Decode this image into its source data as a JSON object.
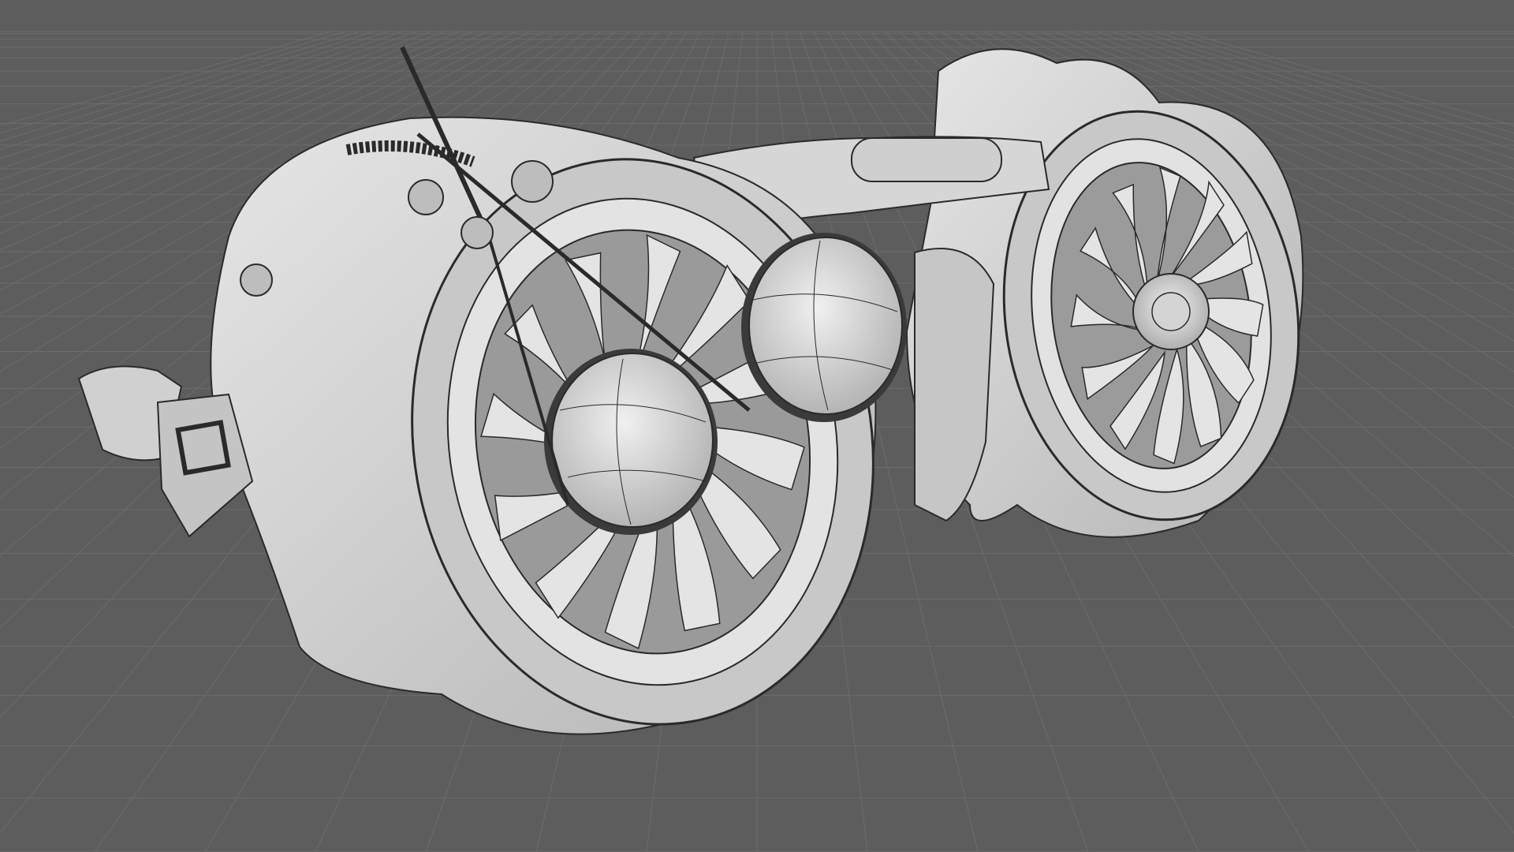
{
  "viewport": {
    "background_color": "#5d5d5d",
    "grid_color": "#6c6c6c",
    "model_fill": "#d8d8d8",
    "model_shadow": "#a9a9a9",
    "wire_color": "#2a2a2a",
    "shading_mode": "shaded-with-wireframe"
  },
  "scene": {
    "object": "steampunk-goggles-with-turbine-fans",
    "parts": [
      {
        "name": "left-fan-housing-icon"
      },
      {
        "name": "right-fan-housing-icon"
      },
      {
        "name": "left-lens-icon"
      },
      {
        "name": "right-lens-icon"
      },
      {
        "name": "bridge-piece-icon"
      },
      {
        "name": "antenna-rod-icon"
      },
      {
        "name": "strap-buckle-icon"
      }
    ]
  }
}
